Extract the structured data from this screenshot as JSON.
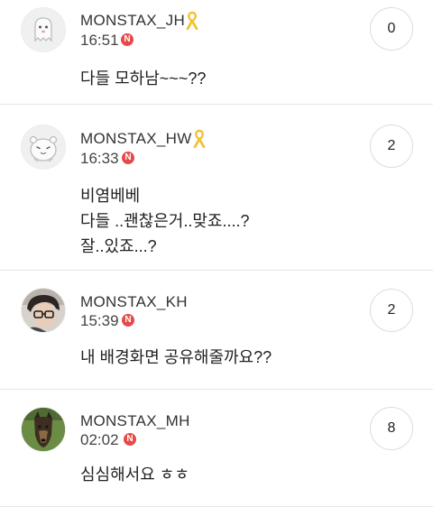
{
  "posts": [
    {
      "username": "MONSTAX_JH",
      "time": "16:51",
      "badge": "N",
      "ribbon": true,
      "avatar": "ghost-character-icon",
      "count": "0",
      "body": "다들 모하남~~~??"
    },
    {
      "username": "MONSTAX_HW",
      "time": "16:33",
      "badge": "N",
      "ribbon": true,
      "avatar": "hamster-character-icon",
      "count": "2",
      "body": "비염베베\n다들 ..괜찮은거..맞죠....?\n잘..있죠...?"
    },
    {
      "username": "MONSTAX_KH",
      "time": "15:39",
      "badge": "N",
      "ribbon": false,
      "avatar": "person-photo",
      "count": "2",
      "body": "내 배경화면 공유해줄까요??"
    },
    {
      "username": "MONSTAX_MH",
      "time": "02:02",
      "badge": "N",
      "ribbon": false,
      "avatar": "dog-photo",
      "count": "8",
      "body": "심심해서요 ㅎㅎ"
    }
  ],
  "colors": {
    "badge": "#e74a4a",
    "ribbon": "#f2c230",
    "divider": "#e6e6e6"
  }
}
